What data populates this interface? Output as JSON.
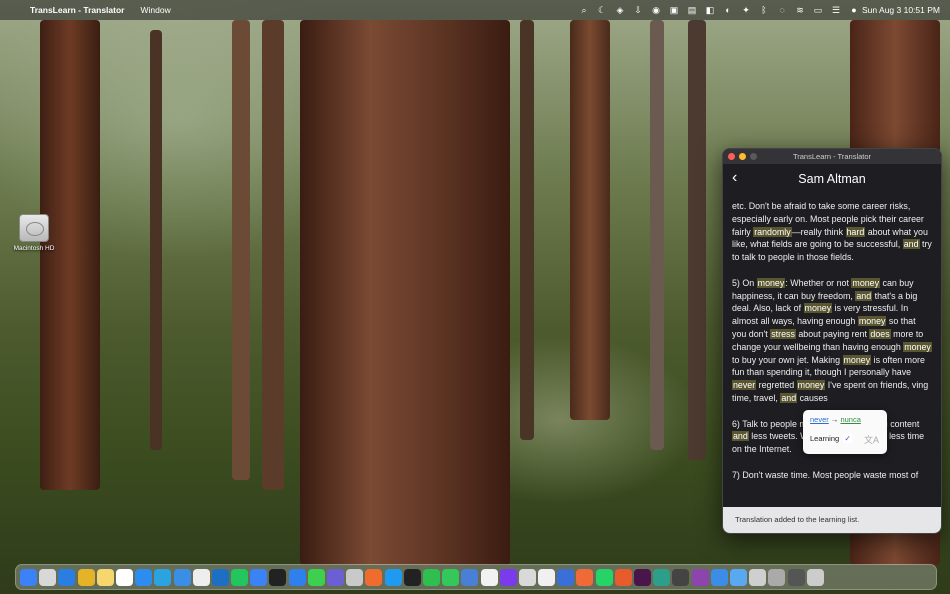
{
  "menubar": {
    "app_name": "TransLearn - Translator",
    "menus": [
      "Window"
    ],
    "clock": "Sun Aug 3  10:51 PM",
    "status_icons": [
      "search-icon",
      "moon-icon",
      "shield-icon",
      "download-icon",
      "record-icon",
      "screenshot-icon",
      "clipboard-icon",
      "notes-icon",
      "vpn-icon",
      "bug-icon",
      "bluetooth-icon",
      "chat-icon",
      "wifi-icon",
      "battery-icon",
      "control-center-icon",
      "user-icon"
    ]
  },
  "desktop": {
    "disk_label": "Macintosh HD"
  },
  "window": {
    "title": "TransLearn - Translator",
    "header_title": "Sam Altman",
    "back_icon": "chevron-left-icon",
    "paragraphs": [
      [
        {
          "t": "etc.  Don't be afraid to take some career risks, especially early on.  Most people pick their career fairly "
        },
        {
          "t": "randomly",
          "h": true
        },
        {
          "t": "—really think "
        },
        {
          "t": "hard",
          "h": true
        },
        {
          "t": " about what you like, what fields are going to be successful, "
        },
        {
          "t": "and",
          "h": true
        },
        {
          "t": " try to talk to people in those fields."
        }
      ],
      [
        {
          "t": "5) On "
        },
        {
          "t": "money",
          "h": true
        },
        {
          "t": ": Whether or not "
        },
        {
          "t": "money",
          "h": true
        },
        {
          "t": " can buy happiness, it can buy freedom, "
        },
        {
          "t": "and",
          "h": true
        },
        {
          "t": " that's a big deal.  Also, lack of "
        },
        {
          "t": "money",
          "h": true
        },
        {
          "t": " is very stressful.  In almost all ways, having enough "
        },
        {
          "t": "money",
          "h": true
        },
        {
          "t": " so that you don't "
        },
        {
          "t": "stress",
          "h": true
        },
        {
          "t": " about paying rent "
        },
        {
          "t": "does",
          "h": true
        },
        {
          "t": " more to change your wellbeing than having enough "
        },
        {
          "t": "money",
          "h": true
        },
        {
          "t": " to buy your own jet.  Making "
        },
        {
          "t": "money",
          "h": true
        },
        {
          "t": " is often more fun than spending it, though I personally have "
        },
        {
          "t": "never",
          "h": true
        },
        {
          "t": " regretted "
        },
        {
          "t": "money",
          "h": true
        },
        {
          "t": " I've spent on friends, "
        },
        {
          "t": "                       "
        },
        {
          "t": "ving time, travel, "
        },
        {
          "t": "and",
          "h": true
        },
        {
          "t": " causes"
        }
      ],
      [
        {
          "t": "6) Talk to people more.  Read more long content "
        },
        {
          "t": "and",
          "h": true
        },
        {
          "t": " less tweets.  Watch less TV.  Spend less time on the Internet."
        }
      ],
      [
        {
          "t": "7) Don't waste time.  Most people waste most of"
        }
      ]
    ],
    "popover": {
      "source_word": "never",
      "arrow": "→",
      "target_word": "nunca",
      "learning_label": "Learning",
      "learning_checked": true,
      "translate_icon": "translate-icon"
    },
    "toast": "Translation added to the learning list."
  },
  "dock": {
    "apps": [
      {
        "name": "finder",
        "color": "#3b82f6"
      },
      {
        "name": "launchpad",
        "color": "#d8d8d8"
      },
      {
        "name": "safari",
        "color": "#2a7de1"
      },
      {
        "name": "chrome",
        "color": "#e4b328"
      },
      {
        "name": "notes",
        "color": "#f5d76e"
      },
      {
        "name": "calendar",
        "color": "#ffffff"
      },
      {
        "name": "app-store",
        "color": "#2d8cf0"
      },
      {
        "name": "telegram",
        "color": "#2aa3e0"
      },
      {
        "name": "xcode",
        "color": "#3a8ee6"
      },
      {
        "name": "chatgpt",
        "color": "#eeeeee"
      },
      {
        "name": "trello",
        "color": "#1d6fc4"
      },
      {
        "name": "pycharm",
        "color": "#22c55e"
      },
      {
        "name": "maps",
        "color": "#3b82f6"
      },
      {
        "name": "unity",
        "color": "#222222"
      },
      {
        "name": "vscode",
        "color": "#2f80ed"
      },
      {
        "name": "messages",
        "color": "#3ecf4e"
      },
      {
        "name": "github-desktop",
        "color": "#6b5fd3"
      },
      {
        "name": "preview",
        "color": "#c9c9c9"
      },
      {
        "name": "proxyman",
        "color": "#ef6c2e"
      },
      {
        "name": "app-store-2",
        "color": "#1e9bf0"
      },
      {
        "name": "terminal",
        "color": "#222222"
      },
      {
        "name": "numbers",
        "color": "#2fbf4e"
      },
      {
        "name": "facetime",
        "color": "#34c759"
      },
      {
        "name": "simulator",
        "color": "#4a7fd8"
      },
      {
        "name": "yandex",
        "color": "#f2f2f2"
      },
      {
        "name": "obsidian",
        "color": "#7c3aed"
      },
      {
        "name": "calculator",
        "color": "#d9d9d9"
      },
      {
        "name": "textedit",
        "color": "#f0f0f0"
      },
      {
        "name": "teams",
        "color": "#3b6fd8"
      },
      {
        "name": "swift",
        "color": "#f06a38"
      },
      {
        "name": "whatsapp",
        "color": "#25d366"
      },
      {
        "name": "firefox",
        "color": "#e85b2c"
      },
      {
        "name": "slack",
        "color": "#4a154b"
      },
      {
        "name": "copilot",
        "color": "#2c9f8a"
      },
      {
        "name": "console",
        "color": "#444444"
      },
      {
        "name": "podcasts",
        "color": "#8e44ad"
      },
      {
        "name": "mail",
        "color": "#3b8de8"
      },
      {
        "name": "finder-2",
        "color": "#5aa8f0"
      },
      {
        "name": "shield",
        "color": "#cfcfcf"
      },
      {
        "name": "downloads",
        "color": "#aaaaaa"
      },
      {
        "name": "stack",
        "color": "#555555"
      },
      {
        "name": "trash",
        "color": "#cccccc"
      }
    ]
  }
}
